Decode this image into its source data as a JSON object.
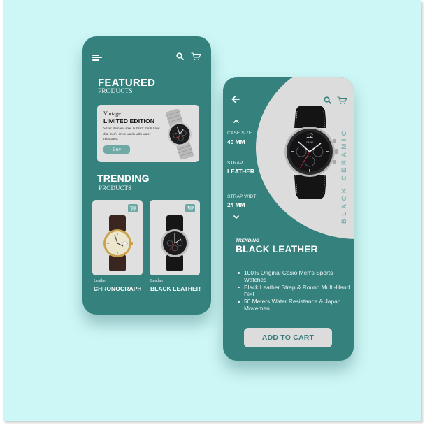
{
  "colors": {
    "background": "#ccf7f6",
    "phone": "#35817e",
    "card": "#e0e0e0",
    "accent_button": "#6fa9a6",
    "vertical_text": "#7fb4b1"
  },
  "home_screen": {
    "header": {
      "icons": [
        "menu-icon",
        "search-icon",
        "cart-icon"
      ]
    },
    "featured": {
      "title": "FEATURED",
      "subtitle": "PRODUCTS",
      "card": {
        "eyebrow": "Vintage",
        "title": "LIMITED EDITION",
        "description": "Silver stainless steel & black multi hand dial men's dress watch with water resistance.",
        "button_label": "Buy"
      }
    },
    "trending": {
      "title": "TRENDING",
      "subtitle": "PRODUCTS",
      "products": [
        {
          "category": "Leather",
          "name": "CHRONOGRAPH"
        },
        {
          "category": "Leather",
          "name": "BLACK LEATHER"
        }
      ]
    }
  },
  "detail_screen": {
    "header": {
      "icons": [
        "back-arrow-icon",
        "search-icon",
        "cart-icon"
      ]
    },
    "specs": [
      {
        "label": "CASE SIZE",
        "value": "40 MM"
      },
      {
        "label": "STRAP",
        "value": "LEATHER"
      },
      {
        "label": "STRAP WIDTH",
        "value": "24 MM"
      }
    ],
    "vertical_label": "BLACK CERAMIC",
    "eyebrow": "TRENDING",
    "title": "BLACK LEATHER",
    "features": [
      "100% Original Casio Men's Sports Watches",
      "Black Leather Strap & Round Multi-Hand Dial",
      "50 Meters Water Resistance & Japan Movemen"
    ],
    "cta_label": "ADD TO CART"
  }
}
